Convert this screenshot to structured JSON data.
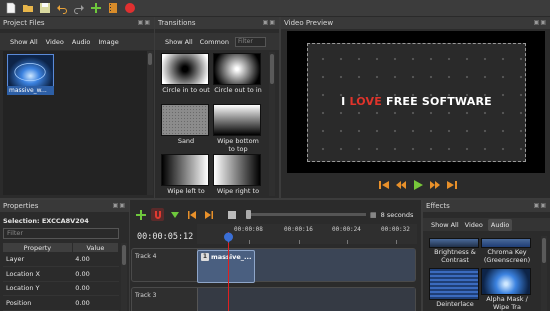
{
  "toolbar": {
    "buttons": [
      "new-project-icon",
      "open-project-icon",
      "save-project-icon",
      "undo-icon",
      "redo-icon",
      "add-track-icon",
      "export-film-icon",
      "record-icon"
    ]
  },
  "project_files": {
    "title": "Project Files",
    "controls": "▣▣",
    "filters": [
      "Show All",
      "Video",
      "Audio",
      "Image"
    ],
    "items": [
      {
        "label": "massive_w..."
      }
    ]
  },
  "transitions": {
    "title": "Transitions",
    "controls": "▣▣",
    "filters": [
      "Show All",
      "Common"
    ],
    "filter_placeholder": "Filter",
    "items": [
      {
        "label": "Circle in to out"
      },
      {
        "label": "Circle out to in"
      },
      {
        "label": "Sand"
      },
      {
        "label": "Wipe bottom to top"
      },
      {
        "label": "Wipe left to"
      },
      {
        "label": "Wipe right to"
      }
    ]
  },
  "video_preview": {
    "title": "Video Preview",
    "controls": "▣▣",
    "overlay": {
      "part1": "I ",
      "part2": "LOVE ",
      "part3": "FREE ",
      "part4": "SOFTWARE"
    }
  },
  "properties": {
    "title": "Properties",
    "controls": "▣▣",
    "selection": "Selection: EXCCA8V204",
    "filter_placeholder": "Filter",
    "columns": [
      "Property",
      "Value"
    ],
    "rows": [
      {
        "property": "Layer",
        "value": "4.00"
      },
      {
        "property": "Location X",
        "value": "0.00"
      },
      {
        "property": "Location Y",
        "value": "0.00"
      },
      {
        "property": "Position",
        "value": "0.00"
      }
    ]
  },
  "timeline": {
    "zoom_label": "8 seconds",
    "current_time": "00:00:05:12",
    "ticks": [
      "00:00:08",
      "00:00:16",
      "00:00:24",
      "00:00:32"
    ],
    "tracks": [
      {
        "label": "Track 4"
      },
      {
        "label": "Track 3"
      }
    ],
    "clip": {
      "badge": "1",
      "label": "massive_..."
    }
  },
  "effects": {
    "title": "Effects",
    "controls": "▣▣",
    "filters": [
      "Show All",
      "Video",
      "Audio"
    ],
    "items": [
      {
        "label": "Brightness & Contrast"
      },
      {
        "label": "Chroma Key (Greenscreen)"
      },
      {
        "label": "Deinterlace"
      },
      {
        "label": "Alpha Mask / Wipe Tra"
      }
    ]
  }
}
